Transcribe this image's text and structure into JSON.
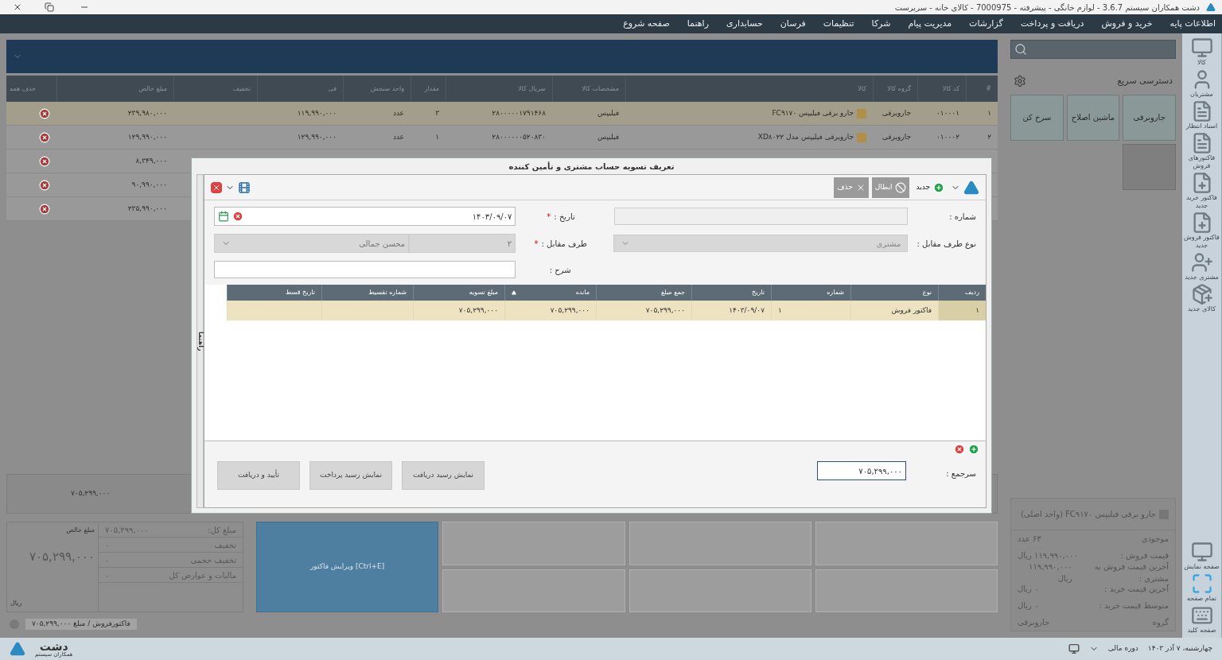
{
  "window": {
    "title": "دشت همکاران سیستم 3.6.7 - لوازم خانگی - پیشرفته - 7000975 - کالای خانه - سرپرست"
  },
  "menu": [
    "اطلاعات پایه",
    "خرید و فروش",
    "دریافت و پرداخت",
    "گزارشات",
    "مدیریت پیام",
    "شرکا",
    "تنظیمات",
    "فرسان",
    "حسابداری",
    "راهنما",
    "صفحه شروع"
  ],
  "invoice_table": {
    "columns": [
      "#",
      "کد کالا",
      "گروه کالا",
      "کالا",
      "مشخصات کالا",
      "سریال کالا",
      "مقدار",
      "واحد سنجش",
      "فی",
      "تخفیف",
      "مبلغ خالص",
      "حذف همه"
    ],
    "rows": [
      {
        "selected": true,
        "number": "۱",
        "code": "۰۱۰۰۰۱",
        "group": "جاروبرقی",
        "item": "جارو برقی فیلیپس FC۹۱۷۰",
        "spec": "فیلیپس",
        "serial": "۲۸۰۰۰۰۰۱۷۹۱۴۶۸",
        "qty": "۳",
        "unit": "عدد",
        "price": "۱۱۹,۹۹۰,۰۰۰",
        "net": "۲۳۹,۹۸۰,۰۰۰"
      },
      {
        "selected": false,
        "number": "۲",
        "code": "۰۱۰۰۰۲",
        "group": "جاروبرقی",
        "item": "جاروبرقی فیلیپس مدل XD۸۰۲۲",
        "spec": "فیلیپس",
        "serial": "۲۸۰۰۰۰۰۰۵۲۰۸۳۰",
        "qty": "۱",
        "unit": "عدد",
        "price": "۱۲۹,۹۹۰,۰۰۰",
        "net": "۱۲۹,۹۹۰,۰۰۰"
      },
      {
        "selected": false,
        "net": "۸,۳۴۹,۰۰۰"
      },
      {
        "selected": false,
        "net": "۹۰,۹۹۰,۰۰۰"
      },
      {
        "selected": false,
        "net": "۲۳۵,۹۹۰,۰۰۰"
      }
    ],
    "total": "۷۰۵,۲۹۹,۰۰۰"
  },
  "summary": {
    "net_label": "مبلغ خالص",
    "net": "۷۰۵,۲۹۹,۰۰۰",
    "currency": "ریال",
    "lines": [
      {
        "label": "مبلغ کل:",
        "value": "۷۰۵,۲۹۹,۰۰۰"
      },
      {
        "label": "تخفیف",
        "value": "۰"
      },
      {
        "label": "تخفیف حجمی",
        "value": "۰"
      },
      {
        "label": "مالیات و عوارض کل",
        "value": "۰"
      }
    ]
  },
  "actions": [
    {
      "label": "[Ctrl+E] ویرایش فاکتور",
      "primary": true
    },
    {
      "primary": false
    },
    {
      "primary": false
    },
    {
      "primary": false
    },
    {
      "primary": false
    },
    {
      "primary": false
    },
    {
      "primary": false
    }
  ],
  "invoice_chip": "فاکتورفروش / مبلغ ۷۰۵,۲۹۹,۰۰۰",
  "quick_access": {
    "title": "دسترسی سریع",
    "tiles": [
      {
        "label": "جاروبرقی"
      },
      {
        "label": "ماشین اصلاح"
      },
      {
        "label": "سرخ کن"
      }
    ]
  },
  "product_info": {
    "title": "جارو برقی فیلیپس FC۹۱۷۰ (واحد اصلی)",
    "rows": [
      {
        "label": "موجودی",
        "value": "۶۳ عدد"
      },
      {
        "label": "قیمت فروش :",
        "value": "۱۱۹,۹۹۰,۰۰۰ ریال"
      },
      {
        "label": "آخرین قیمت فروش به مشتری :",
        "value": "۱۱۹,۹۹۰,۰۰۰ ریال"
      },
      {
        "label": "آخرین قیمت خرید :",
        "value": "۰ ریال"
      },
      {
        "label": "متوسط قیمت خرید :",
        "value": "۰ ریال"
      },
      {
        "label": "گروه",
        "value": "جاروبرقی"
      }
    ]
  },
  "sidebar": {
    "items": [
      {
        "kind": "monitor",
        "label": "کالا"
      },
      {
        "kind": "user",
        "label": "مشتریان"
      },
      {
        "kind": "doc",
        "label": "اسناد انتظار"
      },
      {
        "kind": "doc",
        "label": "فاکتورهای فروش"
      },
      {
        "kind": "docplus",
        "label": "فاکتور خرید جدید"
      },
      {
        "kind": "docplus",
        "label": "فاکتور فروش جدید"
      },
      {
        "kind": "userplus",
        "label": "مشتری جدید"
      },
      {
        "kind": "boxplus",
        "label": "کالای جدید"
      }
    ],
    "bottom": [
      {
        "kind": "screen",
        "label": "صفحه نمایش"
      },
      {
        "kind": "full",
        "label": "تمام صفحه"
      },
      {
        "kind": "keyboard",
        "label": "صفحه کلید"
      }
    ]
  },
  "dialog": {
    "title": "تعریف تسویه حساب مشتری و تأمین کننده",
    "toolbar": [
      {
        "label": "جدید",
        "disabled": false,
        "kind": "new"
      },
      {
        "label": "ابطال",
        "disabled": true,
        "kind": "cancel"
      },
      {
        "label": "حذف",
        "disabled": true,
        "kind": "delete"
      }
    ],
    "fields": {
      "number_label": "شماره :",
      "date_label": "تاریخ :",
      "date_required": true,
      "date": "۱۴۰۳/۰۹/۰۷",
      "party_type_label": "نوع طرف مقابل :",
      "party_type": "مشتری",
      "party_type_disabled": true,
      "party_label": "طرف مقابل :",
      "party_required": true,
      "party_code": "۲",
      "party_name": "محسن جمالی",
      "desc_label": "شرح :",
      "required_mark": "*"
    },
    "side_tab": "راهنما",
    "grid": {
      "columns": [
        "ردیف",
        "نوع",
        "شماره",
        "تاریخ",
        "جمع مبلغ",
        "مانده",
        "مبلغ تسویه",
        "شماره تقسیط",
        "تاریخ قسط"
      ],
      "rows": [
        {
          "selected": true,
          "cells": [
            "۱",
            "فاکتور فروش",
            "۱",
            "۱۴۰۳/۰۹/۰۷",
            "۷۰۵,۲۹۹,۰۰۰",
            "۷۰۵,۲۹۹,۰۰۰",
            "۷۰۵,۲۹۹,۰۰۰"
          ]
        }
      ]
    },
    "total_label": "سرجمع :",
    "total": "۷۰۵,۲۹۹,۰۰۰",
    "buttons": [
      "نمایش رسید دریافت",
      "نمایش رسید پرداخت",
      "تأیید و دریافت"
    ]
  },
  "status_bar": {
    "date": "چهارشنبه، ۷ آذر ۱۴۰۳",
    "period": "دوره مالی",
    "logo": "دشت",
    "logo_sub": "همکاران سیستم"
  }
}
